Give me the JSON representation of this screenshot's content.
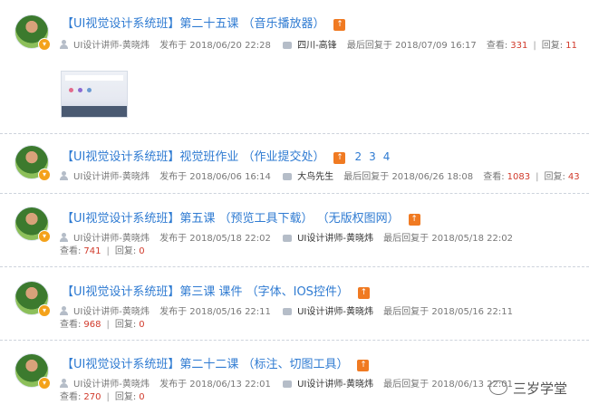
{
  "threads": [
    {
      "title": "【UI视觉设计系统班】第二十五课 （音乐播放器）",
      "author": "UI设计讲师-黄晓炜",
      "posted": "发布于 2018/06/20 22:28",
      "last_user": "四川-高锋",
      "last_reply": "最后回复于 2018/07/09 16:17",
      "views_label": "查看:",
      "views": "331",
      "replies_label": "回复:",
      "replies": "11"
    },
    {
      "title": "【UI视觉设计系统班】视觉班作业 （作业提交处）",
      "pages": [
        "2",
        "3",
        "4"
      ],
      "author": "UI设计讲师-黄晓炜",
      "posted": "发布于 2018/06/06 16:14",
      "last_user": "大鸟先生",
      "last_reply": "最后回复于 2018/06/26 18:08",
      "views_label": "查看:",
      "views": "1083",
      "replies_label": "回复:",
      "replies": "43"
    },
    {
      "title": "【UI视觉设计系统班】第五课 （预览工具下载） （无版权图网）",
      "author": "UI设计讲师-黄晓炜",
      "posted": "发布于 2018/05/18 22:02",
      "last_user": "UI设计讲师-黄晓炜",
      "last_reply": "最后回复于 2018/05/18 22:02",
      "views_label": "查看:",
      "views": "741",
      "replies_label": "回复:",
      "replies": "0"
    },
    {
      "title": "【UI视觉设计系统班】第三课 课件 （字体、IOS控件）",
      "author": "UI设计讲师-黄晓炜",
      "posted": "发布于 2018/05/16 22:11",
      "last_user": "UI设计讲师-黄晓炜",
      "last_reply": "最后回复于 2018/05/16 22:11",
      "views_label": "查看:",
      "views": "968",
      "replies_label": "回复:",
      "replies": "0"
    },
    {
      "title": "【UI视觉设计系统班】第二十二课 （标注、切图工具）",
      "author": "UI设计讲师-黄晓炜",
      "posted": "发布于 2018/06/13 22:01",
      "last_user": "UI设计讲师-黄晓炜",
      "last_reply": "最后回复于 2018/06/13 22:01",
      "views_label": "查看:",
      "views": "270",
      "replies_label": "回复:",
      "replies": "0"
    }
  ],
  "watermark": "三岁学堂",
  "colors": {
    "link": "#2f7bd2",
    "count": "#d13a2b",
    "hot": "#f07a22"
  }
}
